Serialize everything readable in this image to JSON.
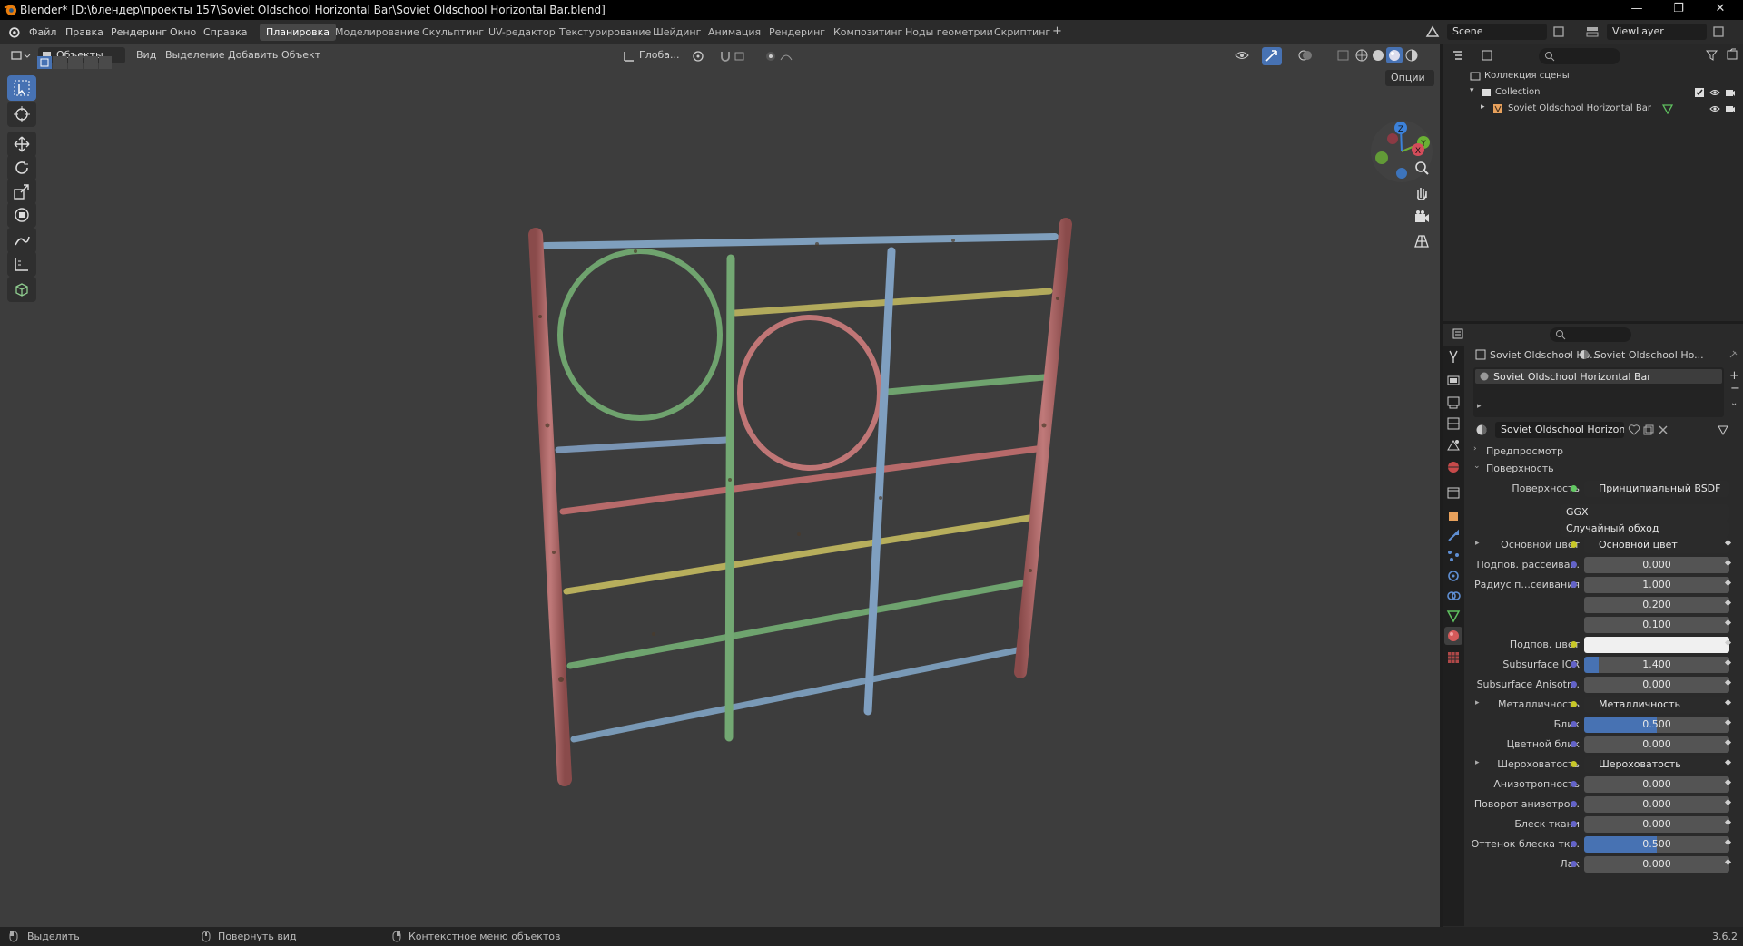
{
  "window": {
    "title": "Blender* [D:\\блендер\\проекты 157\\Soviet Oldschool Horizontal Bar\\Soviet Oldschool Horizontal Bar.blend]",
    "controls": [
      "—",
      "❐",
      "✕"
    ]
  },
  "menu": {
    "items": [
      "Файл",
      "Правка",
      "Рендеринг",
      "Окно",
      "Справка"
    ]
  },
  "workspaces": [
    "Планировка",
    "Моделирование",
    "Скульптинг",
    "UV-редактор",
    "Текстурирование",
    "Шейдинг",
    "Анимация",
    "Рендеринг",
    "Композитинг",
    "Ноды геометрии",
    "Скриптинг",
    "+"
  ],
  "scene": {
    "name": "Scene",
    "view_layer": "ViewLayer"
  },
  "viewport": {
    "mode": "Объекты",
    "menus": [
      "Вид",
      "Выделение",
      "Добавить",
      "Объект"
    ],
    "transform_orientation": "Глоба...",
    "options_label": "Опции",
    "gizmo_axes": {
      "x": "X",
      "y": "Y",
      "z": "Z"
    }
  },
  "outliner": {
    "root": "Коллекция сцены",
    "collection": "Collection",
    "object": "Soviet Oldschool Horizontal Bar"
  },
  "properties": {
    "breadcrumb": [
      "Soviet Oldschool Ho...",
      "Soviet Oldschool Ho..."
    ],
    "material_slot": "Soviet Oldschool Horizontal Bar",
    "material_name": "Soviet Oldschool Horizontal Bar",
    "panels": {
      "preview": "Предпросмотр",
      "surface": "Поверхность"
    },
    "surface_label": "Поверхность",
    "surface_value": "Принципиальный BSDF",
    "distribution": "GGX",
    "subsurface_method": "Случайный обход",
    "rows": [
      {
        "label": "Основной цвет",
        "value": "Основной цвет",
        "kind": "link"
      },
      {
        "label": "Подпов. рассеива...",
        "value": "0.000"
      },
      {
        "label": "Радиус п...сеивания",
        "value": "1.000"
      },
      {
        "label": "",
        "value": "0.200"
      },
      {
        "label": "",
        "value": "0.100"
      },
      {
        "label": "Подпов. цвет",
        "value": "",
        "kind": "color"
      },
      {
        "label": "Subsurface IOR",
        "value": "1.400",
        "fill": 0.1
      },
      {
        "label": "Subsurface Anisotr...",
        "value": "0.000"
      },
      {
        "label": "Металличность",
        "value": "Металличность",
        "kind": "link"
      },
      {
        "label": "Блик",
        "value": "0.500",
        "fill": 0.5
      },
      {
        "label": "Цветной блик",
        "value": "0.000"
      },
      {
        "label": "Шероховатость",
        "value": "Шероховатость",
        "kind": "link"
      },
      {
        "label": "Анизотропность",
        "value": "0.000"
      },
      {
        "label": "Поворот анизотро...",
        "value": "0.000"
      },
      {
        "label": "Блеск ткани",
        "value": "0.000"
      },
      {
        "label": "Оттенок блеска тк...",
        "value": "0.500",
        "fill": 0.5
      },
      {
        "label": "Лак",
        "value": "0.000"
      }
    ]
  },
  "statusbar": {
    "select": "Выделить",
    "rotate": "Повернуть вид",
    "context": "Контекстное меню объектов",
    "version": "3.6.2"
  },
  "colors": {
    "accent": "#4772b3",
    "viewport_bg": "#3d3d3d",
    "bar_red": "#b86b6b",
    "bar_blue": "#7a9bb8",
    "bar_green": "#6fa06f",
    "bar_yellow": "#b0aa5a"
  }
}
